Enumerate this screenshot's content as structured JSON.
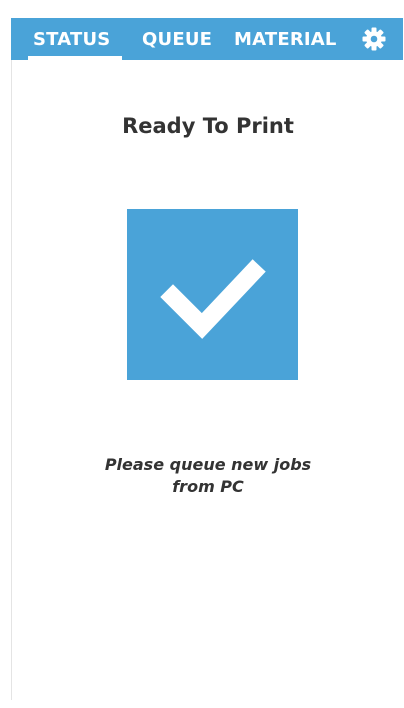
{
  "tabs": {
    "status": "STATUS",
    "queue": "QUEUE",
    "material": "MATERIAL"
  },
  "icons": {
    "settings": "gear-icon",
    "status": "checkmark-icon"
  },
  "main": {
    "title": "Ready To Print",
    "message_line1": "Please queue new jobs",
    "message_line2": "from PC"
  },
  "colors": {
    "accent": "#4aa3d8",
    "text": "#333333",
    "tab_text": "#ffffff"
  }
}
